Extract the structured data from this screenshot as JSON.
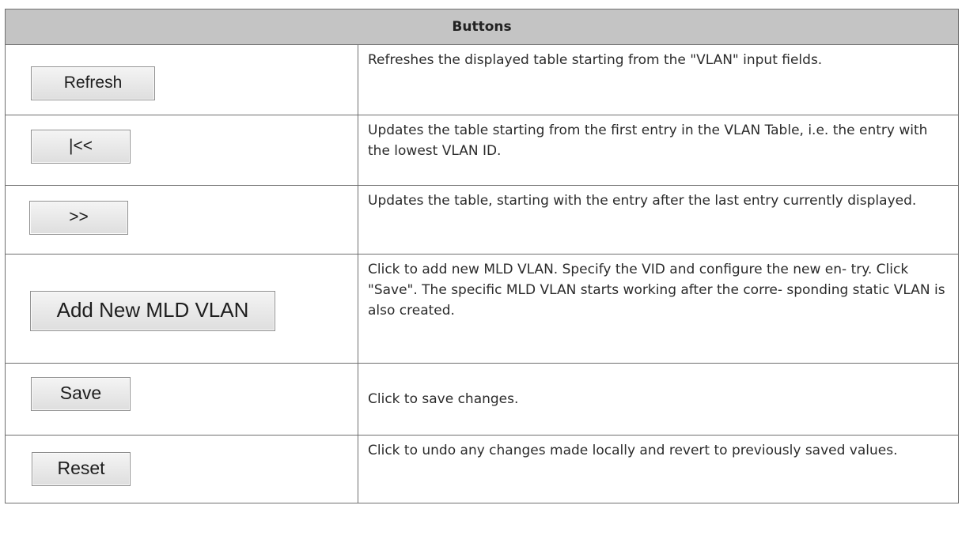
{
  "header": {
    "title": "Buttons"
  },
  "rows": [
    {
      "button_label": "Refresh",
      "description": "Refreshes the displayed table starting from the \"VLAN\" input fields."
    },
    {
      "button_label": "|<<",
      "description": "Updates the table starting from the first entry in the VLAN  Table, i.e. the entry with the lowest VLAN ID."
    },
    {
      "button_label": ">>",
      "description": "Updates the table, starting with the entry after the last entry currently displayed."
    },
    {
      "button_label": "Add New MLD VLAN",
      "description": "Click to add new MLD VLAN. Specify the VID and configure the new en- try. Click \"Save\". The specific MLD VLAN starts working after the corre- sponding static VLAN is also created."
    },
    {
      "button_label": "Save",
      "description": "Click to save changes."
    },
    {
      "button_label": "Reset",
      "description": "Click to undo any changes made locally and revert to previously saved values."
    }
  ]
}
